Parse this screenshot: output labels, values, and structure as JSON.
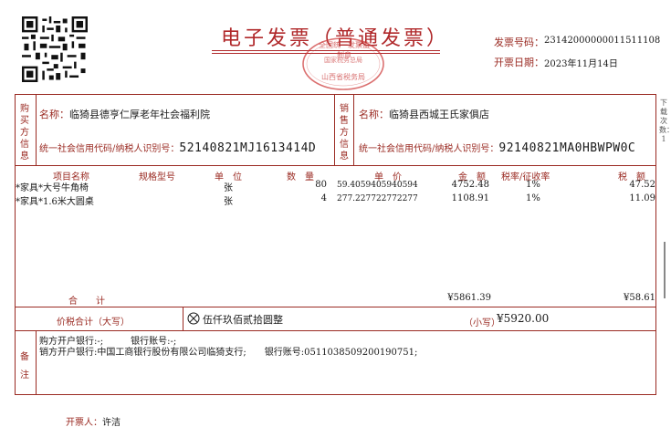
{
  "title": "电子发票（普通发票）",
  "invoice": {
    "number_label": "发票号码：",
    "number": "23142000000011511108",
    "date_label": "开票日期：",
    "date": "2023年11月14日"
  },
  "seal": {
    "ring_text": "全国统一发票监制章",
    "middle_text": "国家税务总局",
    "bottom_text": "山西省税务局"
  },
  "buyer": {
    "side_label": "购买方信息",
    "name_label": "名称：",
    "name": "临猗县德亨仁厚老年社会福利院",
    "tax_label": "统一社会信用代码/纳税人识别号：",
    "tax_id": "52140821MJ1613414D"
  },
  "seller": {
    "side_label": "销售方信息",
    "name_label": "名称：",
    "name": "临猗县西城王氏家俱店",
    "tax_label": "统一社会信用代码/纳税人识别号：",
    "tax_id": "92140821MA0HBWPW0C"
  },
  "items_header": {
    "name": "项目名称",
    "spec": "规格型号",
    "unit": "单　位",
    "qty": "数　量",
    "price": "单　价",
    "amount": "金　额",
    "rate": "税率/征收率",
    "tax": "税　额"
  },
  "items": [
    {
      "name": "*家具*大号牛角椅",
      "unit": "张",
      "qty": "80",
      "price": "59.4059405940594",
      "amount": "4752.48",
      "rate": "1%",
      "tax": "47.52"
    },
    {
      "name": "*家具*1.6米大圆桌",
      "unit": "张",
      "qty": "4",
      "price": "277.227722772277",
      "amount": "1108.91",
      "rate": "1%",
      "tax": "11.09"
    }
  ],
  "totals": {
    "label": "合　　计",
    "amount": "¥5861.39",
    "tax": "¥58.61"
  },
  "grand_total": {
    "label": "价税合计（大写）",
    "words": "伍仟玖佰贰拾圆整",
    "small_label": "（小写）",
    "small_value": "¥5920.00"
  },
  "remarks": {
    "side_label": "备注",
    "line1": "购方开户银行:-;　　　银行账号:-;",
    "line2": "销方开户银行:中国工商银行股份有限公司临猗支行;　　银行账号:0511038509200190751;"
  },
  "issuer": {
    "label": "开票人：",
    "name": "许洁"
  },
  "side_note": "下载次数：1"
}
